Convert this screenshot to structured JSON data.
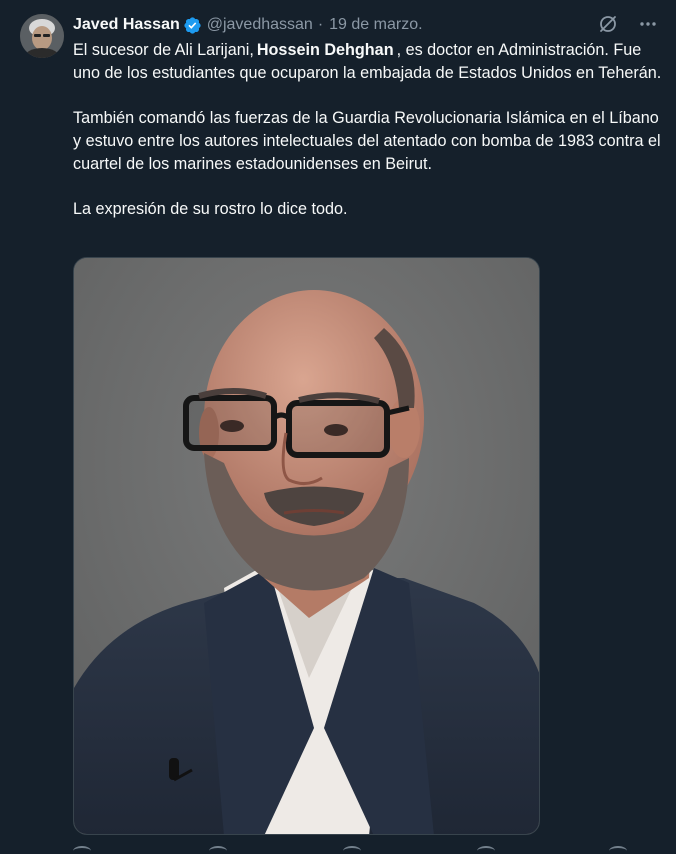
{
  "tweet": {
    "author_name": "Javed Hassan",
    "handle": "@javedhassan",
    "separator": "·",
    "date": "19 de marzo.",
    "verified": true,
    "text": {
      "p1_pre": "El sucesor de Ali Larijani,",
      "p1_mention": "Hossein Dehghan",
      "p1_post": ", es doctor en Administración. Fue uno de los estudiantes que ocuparon la embajada de Estados Unidos en Teherán.",
      "p2": "También comandó las fuerzas de la Guardia Revolucionaria Islámica en el Líbano y estuvo entre los autores intelectuales del atentado con bomba de 1983 contra el cuartel de los marines estadounidenses en Beirut.",
      "p3": "La expresión de su rostro lo dice todo."
    }
  },
  "icons": {
    "verified": "verified-badge-icon",
    "grok": "grok-icon",
    "more": "more-icon"
  },
  "colors": {
    "background": "#15202b",
    "text": "#f7f9f9",
    "secondary": "#8b98a5",
    "verified_blue": "#1d9bf0",
    "border": "#38444d"
  }
}
